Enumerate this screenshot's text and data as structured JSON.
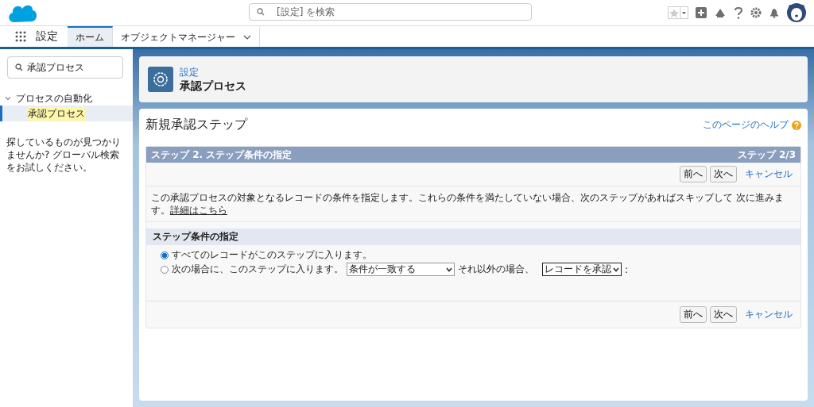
{
  "header": {
    "search": {
      "placeholder": "[設定] を検索"
    }
  },
  "nav": {
    "app_name": "設定",
    "tabs": [
      {
        "label": "ホーム",
        "selected": true,
        "dropdown": false
      },
      {
        "label": "オブジェクトマネージャー",
        "selected": false,
        "dropdown": true
      }
    ]
  },
  "sidebar": {
    "search": {
      "value": "承認プロセス"
    },
    "tree": [
      {
        "label": "プロセスの自動化",
        "expanded": true,
        "children": [
          {
            "label": "承認プロセス",
            "selected": true
          }
        ]
      }
    ],
    "hint": "探しているものが見つかりませんか? グローバル検索をお試しください。"
  },
  "page_header": {
    "breadcrumb": "設定",
    "title": "承認プロセス"
  },
  "content": {
    "title": "新規承認ステップ",
    "help_link": "このページのヘルプ",
    "step_bar": {
      "title": "ステップ 2. ステップ条件の指定",
      "counter": "ステップ 2/3"
    },
    "top_actions": {
      "buttons": [
        "前へ",
        "次へ"
      ],
      "cancel": "キャンセル"
    },
    "description": "この承認プロセスの対象となるレコードの条件を指定します。これらの条件を満たしていない場合、次のステップがあればスキップして 次に進みます。",
    "details_link": "詳細はこちら",
    "section_title": "ステップ条件の指定",
    "options": [
      {
        "label": "すべてのレコードがこのステップに入ります。",
        "selected": true
      },
      {
        "label": "次の場合に、このステップに入ります。",
        "selected": false,
        "criteria": "条件が一致する",
        "else_label": "それ以外の場合、",
        "else_action": "レコードを承認",
        "suffix": ":"
      }
    ],
    "bottom_actions": {
      "buttons": [
        "前へ",
        "次へ"
      ],
      "cancel": "キャンセル"
    }
  }
}
